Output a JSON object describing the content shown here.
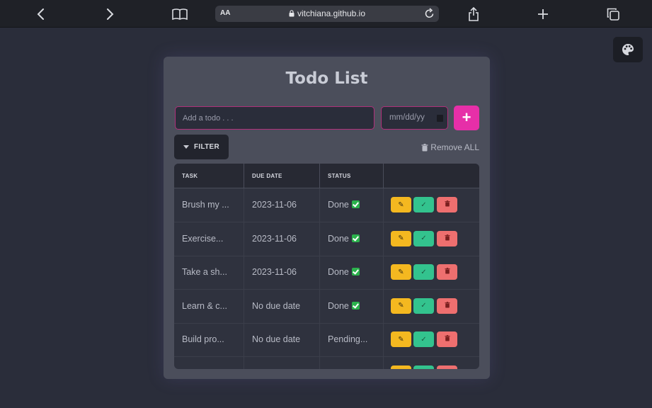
{
  "browser": {
    "text_size_label": "AA",
    "url": "vitchiana.github.io"
  },
  "app": {
    "title": "Todo List",
    "todo_placeholder": "Add a todo . . .",
    "date_placeholder": "mm/dd/yy",
    "add_label": "+",
    "filter_label": "FILTER",
    "remove_all_label": "Remove ALL"
  },
  "table": {
    "headers": [
      "TASK",
      "DUE DATE",
      "STATUS",
      ""
    ],
    "rows": [
      {
        "task": "Brush my ...",
        "due": "2023-11-06",
        "status": "Done",
        "done": true
      },
      {
        "task": "Exercise...",
        "due": "2023-11-06",
        "status": "Done",
        "done": true
      },
      {
        "task": "Take a sh...",
        "due": "2023-11-06",
        "status": "Done",
        "done": true
      },
      {
        "task": "Learn & c...",
        "due": "No due date",
        "status": "Done",
        "done": true
      },
      {
        "task": "Build pro...",
        "due": "No due date",
        "status": "Pending...",
        "done": false
      },
      {
        "task": "",
        "due": "",
        "status": "",
        "done": false
      }
    ]
  },
  "colors": {
    "accent": "#e62fa8",
    "edit": "#f4b820",
    "complete": "#33c38e",
    "delete": "#ee6f6f"
  },
  "icons": [
    "back-icon",
    "forward-icon",
    "bookmarks-icon",
    "lock-icon",
    "reload-icon",
    "share-icon",
    "new-tab-icon",
    "tabs-icon",
    "palette-icon",
    "trash-icon",
    "pencil-icon",
    "check-icon"
  ]
}
